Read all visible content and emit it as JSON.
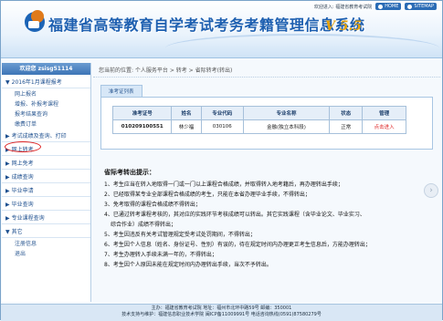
{
  "header": {
    "title": "福建省高等教育自学考试考务考籍管理信息系统",
    "version": "V 5.5",
    "welcome_text": "欢迎进入: 福建省教育考试院",
    "home_label": "HOME",
    "sitemap_label": "SITEMAP"
  },
  "sidebar": {
    "welcome": "欢迎您 zsisg51114",
    "groups": [
      {
        "label": "2016年1月课程报考",
        "expanded": true,
        "items": [
          "网上报名",
          "增报、补报考课程",
          "报考结果查询",
          "缴费订单"
        ]
      },
      {
        "label": "考试成绩及查询、打印",
        "expanded": false,
        "items": []
      },
      {
        "label": "网上转考",
        "expanded": false,
        "items": [],
        "highlighted": true
      },
      {
        "label": "网上免考",
        "expanded": false,
        "items": []
      },
      {
        "label": "成绩查询",
        "expanded": false,
        "items": []
      },
      {
        "label": "毕业申请",
        "expanded": false,
        "items": []
      },
      {
        "label": "毕业查询",
        "expanded": false,
        "items": []
      },
      {
        "label": "专业课程查询",
        "expanded": false,
        "items": []
      },
      {
        "label": "其它",
        "expanded": true,
        "items": [
          "注册信息",
          "退出"
        ]
      }
    ]
  },
  "main": {
    "breadcrumb": "您当前的位置: 个人服务平台 > 转考 > 省际转考(转出)",
    "panel_tab": "准考证列表",
    "table": {
      "headers": [
        "准考证号",
        "姓名",
        "专业代码",
        "专业名称",
        "状态",
        "管理"
      ],
      "rows": [
        [
          "010209100551",
          "林少福",
          "030106",
          "金融(独立本科段)",
          "正常",
          "点击进入"
        ]
      ]
    },
    "notice": {
      "title": "省际考转出提示：",
      "items": [
        "1、考生应当在转入地取得一门或一门以上课程合格成绩，并取得转入地考籍后，再办理转出手续；",
        "2、已经取得某专业全部课程合格成绩的考生，只能在本省办理毕业手续，不得转出；",
        "3、免考取得的课程合格成绩不得转出；",
        "4、已通过转考课程考核的，其对应的实践环节考核成绩可以转出。其它实践课程（含毕业论文、毕业实习、综合作业）成绩不得转出；",
        "5、考生因违反有关考试管理规定受考试处罚期间，不得转出；",
        "6、考生因个人信息（姓名、身份证号、性别）有误的，待在规定时间内办理更正考生信息后，方能办理转出；",
        "7、考生办理转入手续未满一年的，不得转出；",
        "8、考生因个人原因未能在规定时间内办理转出手续，当次不予转出。"
      ]
    }
  },
  "footer": {
    "line1": "主办：福建省教育考试院      地址：福州市北环中路59号      邮编：350001",
    "line2": "技术支持与维护：福建信息职业技术学院      闽ICP备11009991号      电话咨询热线(0591)87580279号"
  },
  "colors": {
    "brand": "#1d5fb0",
    "accent": "#e6a10a",
    "link_red": "#dd2222"
  }
}
